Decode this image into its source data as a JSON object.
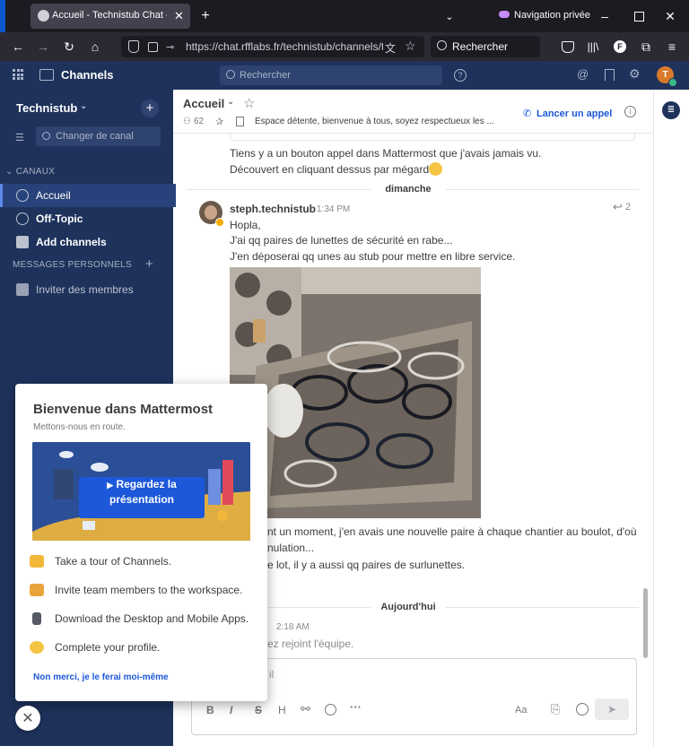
{
  "browser": {
    "tab_title": "Accueil - Technistub Chat — RFF",
    "private_label": "Navigation privée",
    "url": "https://chat.rfflabs.fr/technistub/channels/to",
    "search_placeholder": "Rechercher"
  },
  "app": {
    "product_label": "Channels",
    "search_placeholder": "Rechercher",
    "avatar_letter": "T"
  },
  "sidebar": {
    "team_name": "Technistub",
    "filter_placeholder": "Changer de canal",
    "channels_header": "CANAUX",
    "channels": [
      {
        "label": "Accueil"
      },
      {
        "label": "Off-Topic"
      },
      {
        "label": "Add channels"
      }
    ],
    "dm_header": "MESSAGES PERSONNELS",
    "invite_label": "Inviter des membres"
  },
  "channel": {
    "name": "Accueil",
    "member_count": "62",
    "purpose": "Espace détente, bienvenue à tous, soyez respectueux les ...",
    "call_label": "Lancer un appel"
  },
  "posts": {
    "top_lines": [
      "Tiens y a un bouton appel dans Mattermost que j'avais jamais vu.",
      "Découvert en cliquant dessus par mégarde"
    ],
    "date_sep_1": "dimanche",
    "author": "steph.technistub",
    "time": "1:34 PM",
    "reply_count": "2",
    "lines": [
      "Hopla,",
      "J'ai qq paires de lunettes de sécurité en rabe...",
      "J'en déposerai qq unes au stub pour mettre en libre service."
    ],
    "after_image_lines": [
      "nt un moment, j'en avais une nouvelle paire à chaque chantier au boulot, d'où",
      "nulation...",
      "e lot, il y a aussi qq paires de surlunettes."
    ],
    "date_sep_2": "Aujourd'hui",
    "system_time": "2:18 AM",
    "system_text": "ez rejoint l'équipe."
  },
  "editor": {
    "placeholder_fragment": "il",
    "format_buttons": [
      "B",
      "I",
      "S",
      "H"
    ],
    "font_label": "Aa"
  },
  "onboarding": {
    "title": "Bienvenue dans Mattermost",
    "subtitle": "Mettons-nous en route.",
    "video_button": "Regardez la présentation",
    "steps": [
      {
        "label": "Take a tour of Channels.",
        "icon": "flag-icon"
      },
      {
        "label": "Invite team members to the workspace.",
        "icon": "handshake-icon"
      },
      {
        "label": "Download the Desktop and Mobile Apps.",
        "icon": "phone-icon"
      },
      {
        "label": "Complete your profile.",
        "icon": "smiley-icon"
      }
    ],
    "skip_link": "Non merci, je le ferai moi-même"
  },
  "colors": {
    "sidebar": "#1e325c",
    "accent": "#1c58d9",
    "browser_dark": "#1c1b22"
  }
}
